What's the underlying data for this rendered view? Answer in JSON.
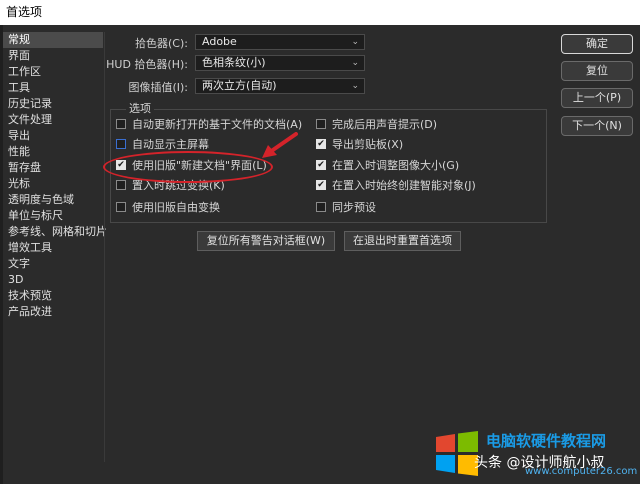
{
  "window": {
    "title": "首选项"
  },
  "sidebar": {
    "items": [
      {
        "label": "常规",
        "selected": true
      },
      {
        "label": "界面"
      },
      {
        "label": "工作区"
      },
      {
        "label": "工具"
      },
      {
        "label": "历史记录"
      },
      {
        "label": "文件处理"
      },
      {
        "label": "导出"
      },
      {
        "label": "性能"
      },
      {
        "label": "暂存盘"
      },
      {
        "label": "光标"
      },
      {
        "label": "透明度与色域"
      },
      {
        "label": "单位与标尺"
      },
      {
        "label": "参考线、网格和切片"
      },
      {
        "label": "增效工具"
      },
      {
        "label": "文字"
      },
      {
        "label": "3D"
      },
      {
        "label": "技术预览"
      },
      {
        "label": "产品改进"
      }
    ]
  },
  "fields": {
    "color_picker": {
      "label": "拾色器(C):",
      "value": "Adobe"
    },
    "hud_picker": {
      "label": "HUD 拾色器(H):",
      "value": "色相条纹(小)"
    },
    "interpolation": {
      "label": "图像插值(I):",
      "value": "两次立方(自动)"
    }
  },
  "options": {
    "title": "选项",
    "left": [
      {
        "label": "自动更新打开的基于文件的文档(A)",
        "checked": false
      },
      {
        "label": "自动显示主屏幕",
        "checked": false,
        "focus": true
      },
      {
        "label": "使用旧版\"新建文档\"界面(L)",
        "checked": true
      },
      {
        "label": "置入时跳过变换(K)",
        "checked": false
      },
      {
        "label": "使用旧版自由变换",
        "checked": false
      }
    ],
    "right": [
      {
        "label": "完成后用声音提示(D)",
        "checked": false
      },
      {
        "label": "导出剪贴板(X)",
        "checked": true
      },
      {
        "label": "在置入时调整图像大小(G)",
        "checked": true
      },
      {
        "label": "在置入时始终创建智能对象(J)",
        "checked": true
      },
      {
        "label": "同步预设",
        "checked": false
      }
    ]
  },
  "buttons": {
    "reset_warnings": "复位所有警告对话框(W)",
    "reset_on_quit": "在退出时重置首选项",
    "ok": "确定",
    "reset": "复位",
    "prev": "上一个(P)",
    "next": "下一个(N)"
  },
  "watermark": {
    "title": "电脑软硬件教程网",
    "author": "头条 @设计师航小叔",
    "url": "www.computer26.com"
  },
  "colors": {
    "accent_red": "#d4232a",
    "background": "#2b2b2b"
  }
}
